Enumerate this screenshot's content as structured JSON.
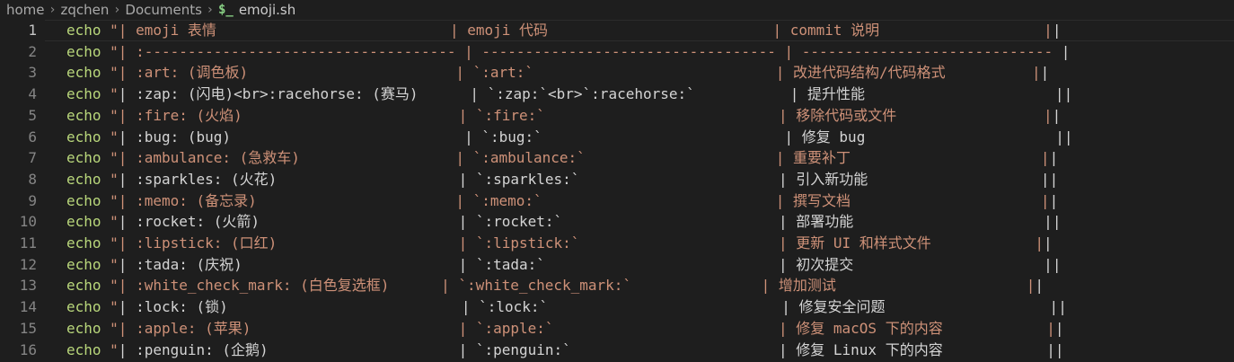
{
  "breadcrumb": {
    "items": [
      "home",
      "zqchen",
      "Documents"
    ],
    "separator": "›",
    "file_icon": "$_",
    "file_name": "emoji.sh"
  },
  "editor": {
    "colors": {
      "background": "#1e1e1e",
      "keyword": "#b9d77b",
      "string": "#ce9178",
      "plain": "#d4d4d4",
      "line_number": "#858585"
    },
    "active_line": 1,
    "lines": [
      {
        "num": "1",
        "kw": "echo",
        "quote": " \"",
        "text": "| emoji 表情                           | emoji 代码                          | commit 说明                   |",
        "tail": "|",
        "style": "str"
      },
      {
        "num": "2",
        "kw": "echo",
        "quote": " \"",
        "text": "| :------------------------------------ | ---------------------------------- | -----------------------------",
        "tail": " |",
        "style": "str"
      },
      {
        "num": "3",
        "kw": "echo",
        "quote": " \"",
        "text": "| :art: (调色板)                        | `:art:`                            | 改进代码结构/代码格式          |",
        "tail": "|",
        "style": "str"
      },
      {
        "num": "4",
        "kw": "echo",
        "quote": " \"",
        "text": "| :zap: (闪电)<br>:racehorse: (赛马)      | `:zap:`<br>`:racehorse:`           | 提升性能                      |",
        "tail": "|",
        "style": "plain"
      },
      {
        "num": "5",
        "kw": "echo",
        "quote": " \"",
        "text": "| :fire: (火焰)                         | `:fire:`                           | 移除代码或文件                 |",
        "tail": "|",
        "style": "str"
      },
      {
        "num": "6",
        "kw": "echo",
        "quote": " \"",
        "text": "| :bug: (bug)                           | `:bug:`                            | 修复 bug                      |",
        "tail": "|",
        "style": "plain"
      },
      {
        "num": "7",
        "kw": "echo",
        "quote": " \"",
        "text": "| :ambulance: (急救车)                  | `:ambulance:`                      | 重要补丁                      |",
        "tail": "|",
        "style": "str"
      },
      {
        "num": "8",
        "kw": "echo",
        "quote": " \"",
        "text": "| :sparkles: (火花)                     | `:sparkles:`                       | 引入新功能                    |",
        "tail": "|",
        "style": "plain"
      },
      {
        "num": "9",
        "kw": "echo",
        "quote": " \"",
        "text": "| :memo: (备忘录)                       | `:memo:`                           | 撰写文档                      |",
        "tail": "|",
        "style": "str"
      },
      {
        "num": "10",
        "kw": "echo",
        "quote": " \"",
        "text": "| :rocket: (火箭)                       | `:rocket:`                         | 部署功能                      |",
        "tail": "|",
        "style": "plain"
      },
      {
        "num": "11",
        "kw": "echo",
        "quote": " \"",
        "text": "| :lipstick: (口红)                     | `:lipstick:`                       | 更新 UI 和样式文件            |",
        "tail": "|",
        "style": "str"
      },
      {
        "num": "12",
        "kw": "echo",
        "quote": " \"",
        "text": "| :tada: (庆祝)                         | `:tada:`                           | 初次提交                      |",
        "tail": "|",
        "style": "plain"
      },
      {
        "num": "13",
        "kw": "echo",
        "quote": " \"",
        "text": "| :white_check_mark: (白色复选框)      | `:white_check_mark:`               | 增加测试                      |",
        "tail": "|",
        "style": "str"
      },
      {
        "num": "14",
        "kw": "echo",
        "quote": " \"",
        "text": "| :lock: (锁)                           | `:lock:`                           | 修复安全问题                   |",
        "tail": "|",
        "style": "plain"
      },
      {
        "num": "15",
        "kw": "echo",
        "quote": " \"",
        "text": "| :apple: (苹果)                        | `:apple:`                          | 修复 macOS 下的内容            |",
        "tail": "|",
        "style": "str"
      },
      {
        "num": "16",
        "kw": "echo",
        "quote": " \"",
        "text": "| :penguin: (企鹅)                      | `:penguin:`                        | 修复 Linux 下的内容            |",
        "tail": "|",
        "style": "plain"
      }
    ]
  }
}
